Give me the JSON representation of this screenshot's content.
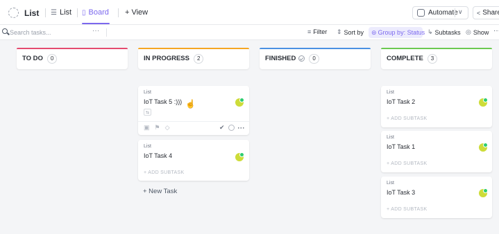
{
  "header": {
    "title": "List",
    "tabs": [
      {
        "label": "List",
        "icon": "list-icon"
      },
      {
        "label": "Board",
        "icon": "board-icon",
        "active": true
      }
    ],
    "add_view": "+ View",
    "automate": "Automate",
    "share": "Share"
  },
  "toolbar": {
    "search_placeholder": "Search tasks...",
    "search_more": "···",
    "filter": "Filter",
    "sort": "Sort by",
    "group": "Group by: Status",
    "subtasks": "Subtasks",
    "show": "Show",
    "more": "···"
  },
  "columns": [
    {
      "name": "TO DO",
      "count": "0",
      "accent": "#e44a6f"
    },
    {
      "name": "IN PROGRESS",
      "count": "2",
      "accent": "#f5a623"
    },
    {
      "name": "FINISHED",
      "count": "0",
      "accent": "#4a90e2"
    },
    {
      "name": "COMPLETE",
      "count": "3",
      "accent": "#6bc950"
    }
  ],
  "cards": {
    "in_progress": [
      {
        "crumb": "List",
        "title": "IoT Task 5 :)))"
      },
      {
        "crumb": "List",
        "title": "IoT Task 4",
        "add_subtask": "+ ADD SUBTASK"
      }
    ],
    "complete": [
      {
        "crumb": "List",
        "title": "IoT Task 2",
        "add_subtask": "+ ADD SUBTASK"
      },
      {
        "crumb": "List",
        "title": "IoT Task 1",
        "add_subtask": "+ ADD SUBTASK"
      },
      {
        "crumb": "List",
        "title": "IoT Task 3",
        "add_subtask": "+ ADD SUBTASK"
      }
    ]
  },
  "new_task": "+ New Task",
  "colors": {
    "accent": "#7b68ee",
    "avatar": "#cddc39",
    "online": "#2ecd6f"
  }
}
